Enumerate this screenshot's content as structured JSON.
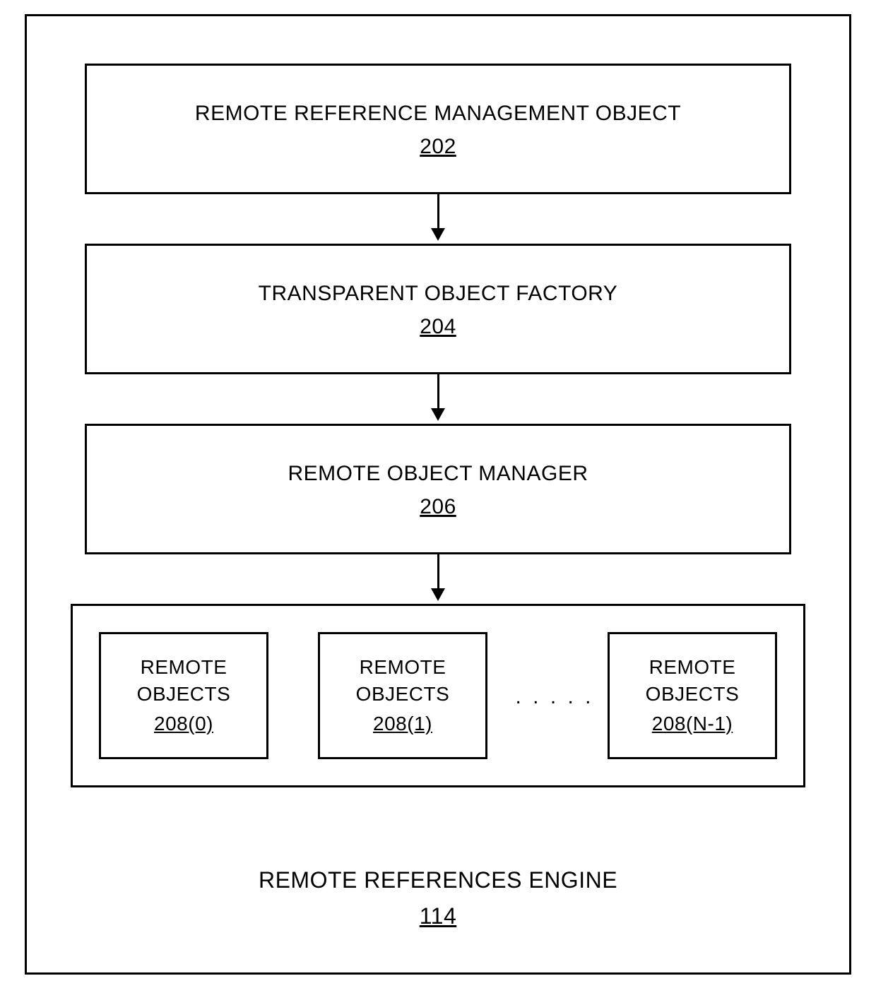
{
  "container": {
    "title": "REMOTE REFERENCES ENGINE",
    "ref": "114"
  },
  "blocks": {
    "b1": {
      "title": "REMOTE REFERENCE MANAGEMENT OBJECT",
      "ref": "202"
    },
    "b2": {
      "title": "TRANSPARENT OBJECT FACTORY",
      "ref": "204"
    },
    "b3": {
      "title": "REMOTE OBJECT MANAGER",
      "ref": "206"
    }
  },
  "objectsRow": {
    "items": [
      {
        "title": "REMOTE OBJECTS",
        "ref": "208(0)"
      },
      {
        "title": "REMOTE OBJECTS",
        "ref": "208(1)"
      },
      {
        "title": "REMOTE OBJECTS",
        "ref": "208(N-1)"
      }
    ],
    "ellipsis": ". . . . ."
  }
}
